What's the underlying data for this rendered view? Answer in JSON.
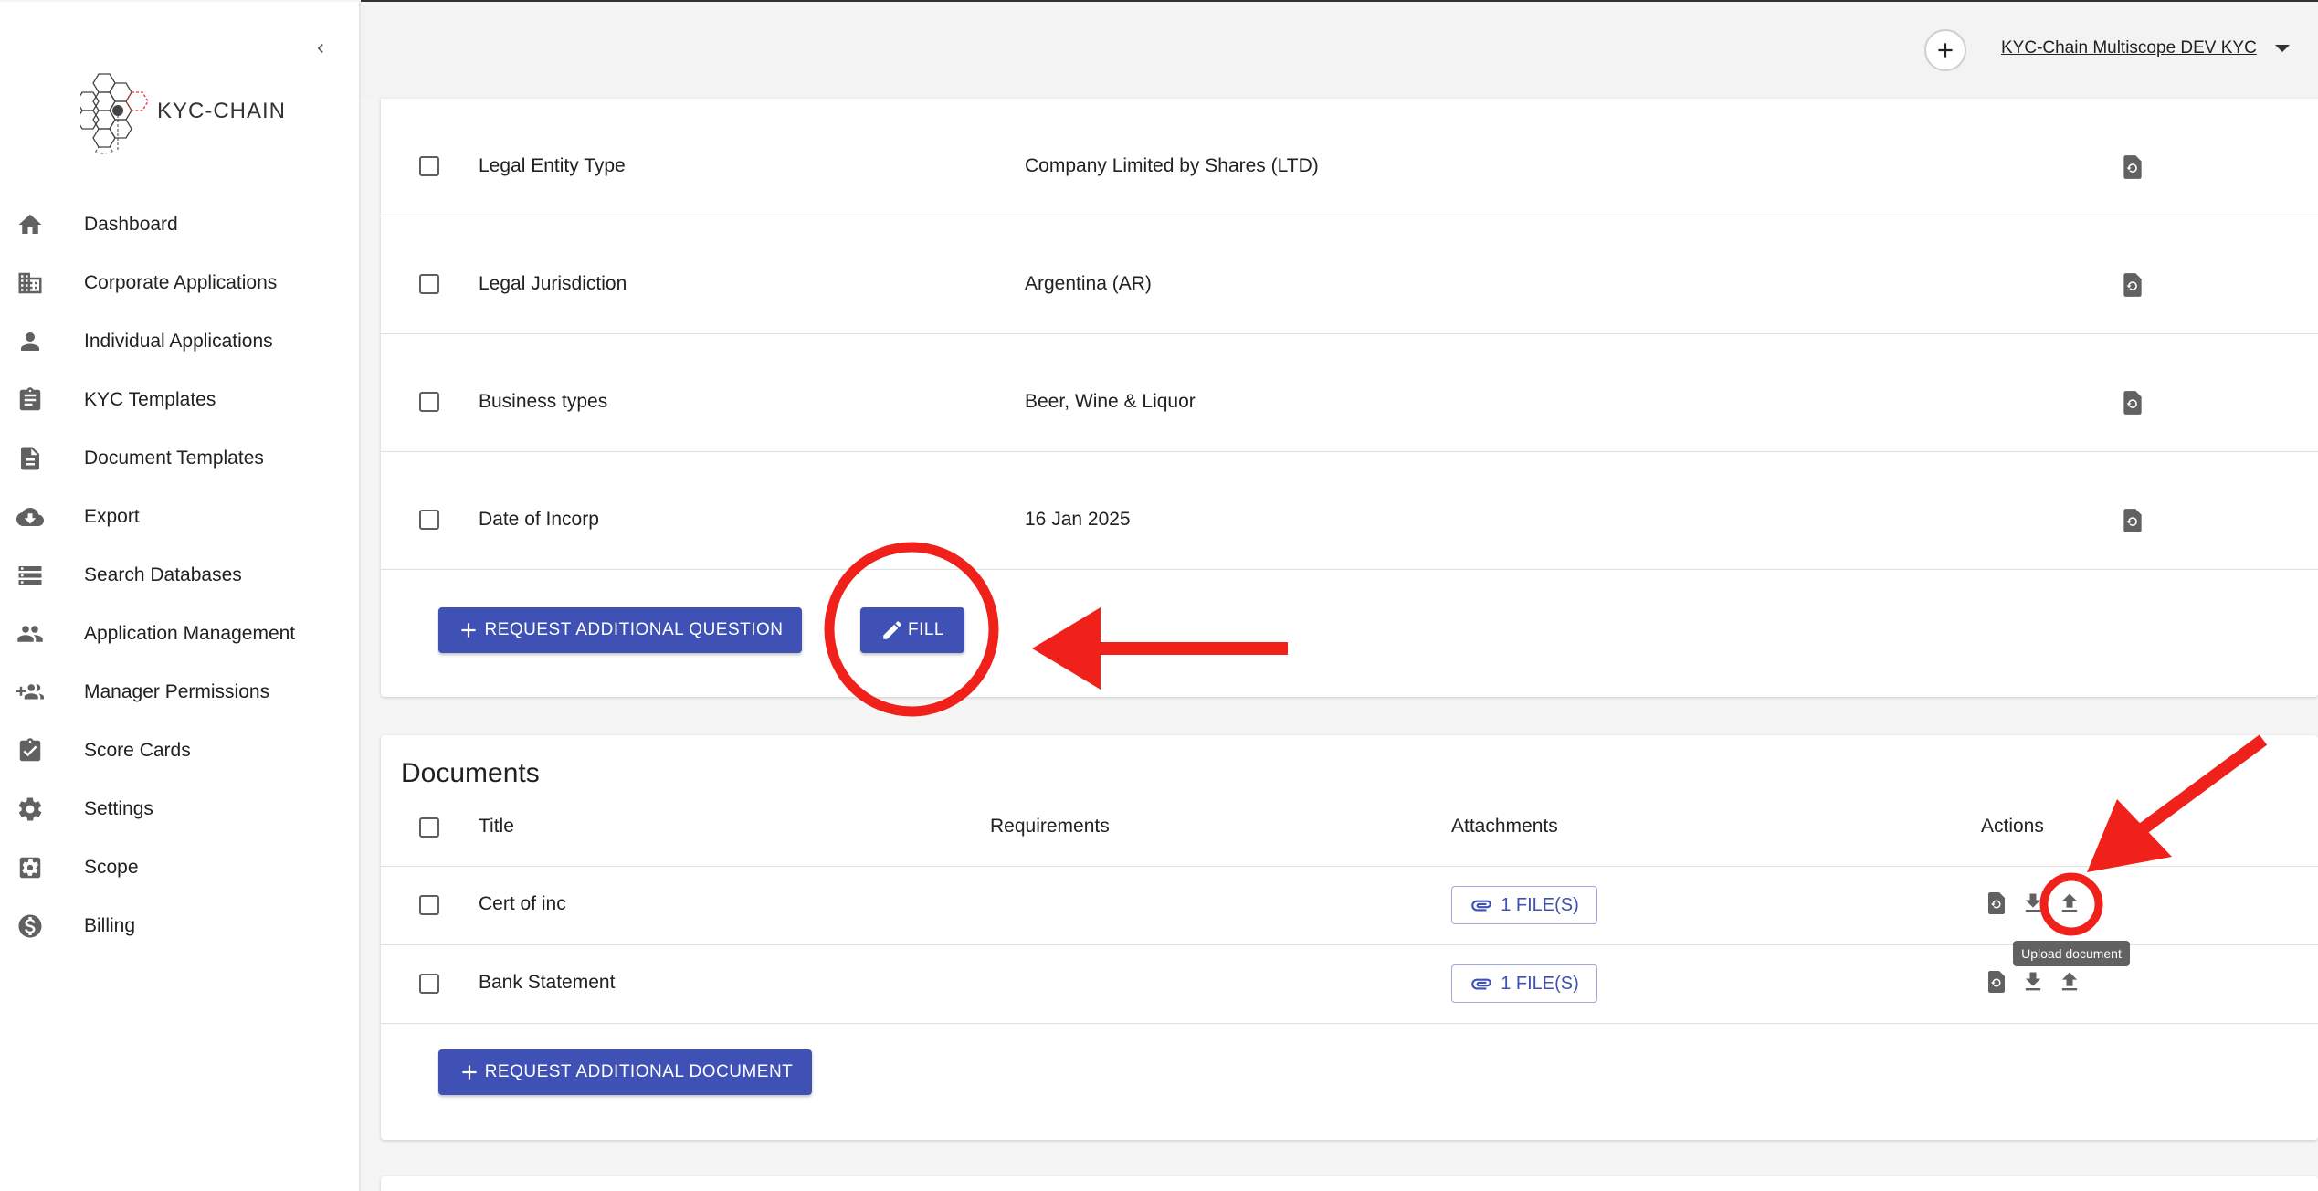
{
  "app": {
    "logo_text": "KYC-CHAIN",
    "scope_selector": "KYC-Chain Multiscope DEV KYC"
  },
  "sidebar": {
    "items": [
      {
        "label": "Dashboard",
        "icon": "home-icon"
      },
      {
        "label": "Corporate Applications",
        "icon": "building-icon"
      },
      {
        "label": "Individual Applications",
        "icon": "person-icon"
      },
      {
        "label": "KYC Templates",
        "icon": "clipboard-icon"
      },
      {
        "label": "Document Templates",
        "icon": "document-icon"
      },
      {
        "label": "Export",
        "icon": "cloud-download-icon"
      },
      {
        "label": "Search Databases",
        "icon": "storage-icon"
      },
      {
        "label": "Application Management",
        "icon": "people-icon"
      },
      {
        "label": "Manager Permissions",
        "icon": "group-add-icon"
      },
      {
        "label": "Score Cards",
        "icon": "assignment-check-icon"
      },
      {
        "label": "Settings",
        "icon": "gear-icon"
      },
      {
        "label": "Scope",
        "icon": "settings-box-icon"
      },
      {
        "label": "Billing",
        "icon": "dollar-icon"
      }
    ]
  },
  "questions": {
    "rows": [
      {
        "label": "Legal Entity Type",
        "value": "Company Limited by Shares (LTD)"
      },
      {
        "label": "Legal Jurisdiction",
        "value": "Argentina (AR)"
      },
      {
        "label": "Business types",
        "value": "Beer, Wine & Liquor"
      },
      {
        "label": "Date of Incorp",
        "value": "16 Jan 2025"
      }
    ],
    "request_button": "REQUEST ADDITIONAL QUESTION",
    "fill_button": "FILL"
  },
  "documents": {
    "title": "Documents",
    "headers": {
      "title": "Title",
      "requirements": "Requirements",
      "attachments": "Attachments",
      "actions": "Actions"
    },
    "rows": [
      {
        "title": "Cert of inc",
        "attachments": "1 FILE(S)"
      },
      {
        "title": "Bank Statement",
        "attachments": "1 FILE(S)"
      }
    ],
    "tooltip": "Upload document",
    "request_button": "REQUEST ADDITIONAL DOCUMENT"
  },
  "colors": {
    "primary": "#3f51b5",
    "annotation": "#f0211b"
  }
}
